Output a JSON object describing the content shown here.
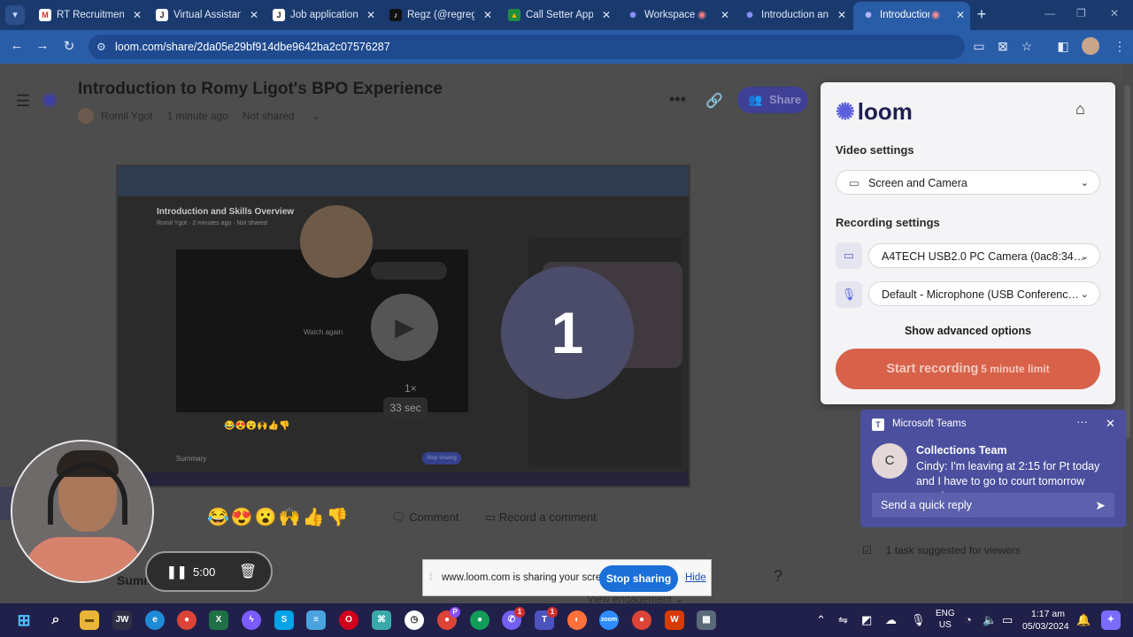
{
  "browser": {
    "tabs": [
      {
        "title": "RT Recruitment S",
        "icon": "gmail-icon",
        "color": "#d93025"
      },
      {
        "title": "Virtual Assistant",
        "icon": "jobstreet-icon",
        "color": "#222"
      },
      {
        "title": "Job application s",
        "icon": "jobstreet-icon",
        "color": "#222"
      },
      {
        "title": "Regz (@regregz",
        "icon": "tiktok-icon",
        "color": "#111"
      },
      {
        "title": "Call Setter Appli",
        "icon": "drive-icon",
        "color": "#f4b400"
      },
      {
        "title": "Workspace S",
        "icon": "loom-icon",
        "color": "#5c5fdc"
      },
      {
        "title": "Introduction and",
        "icon": "loom-icon",
        "color": "#5c5fdc"
      },
      {
        "title": "Introduction",
        "icon": "loom-icon",
        "color": "#5c5fdc"
      }
    ],
    "url": "loom.com/share/2da05e29bf914dbe9642ba2c07576287"
  },
  "page": {
    "title": "Introduction to Romy Ligot's BPO Experience",
    "author": "Romil Ygot",
    "time": "1 minute ago",
    "privacy": "Not shared",
    "share_label": "Share",
    "comment_label": "Comment",
    "record_comment_label": "Record a comment",
    "summary_label": "Summ",
    "view_engagement": "View engagement",
    "task_suggested": "1 task suggested for viewers",
    "reactions": "😂😍😮🙌👍👎"
  },
  "video_thumb": {
    "inner_title": "Introduction and Skills Overview",
    "inner_meta": "Romil Ygot · 2 minutes ago · Not shared",
    "watch_again": "Watch again",
    "speed": "1×",
    "duration": "33 sec",
    "summary": "Summary",
    "stop_sharing": "Stop sharing"
  },
  "countdown": "1",
  "recorder": {
    "timer": "5:00"
  },
  "loom_popup": {
    "brand": "loom",
    "video_settings_label": "Video settings",
    "video_mode": "Screen and Camera",
    "recording_settings_label": "Recording settings",
    "camera": "A4TECH USB2.0 PC Camera (0ac8:34…",
    "microphone": "Default - Microphone (USB Conferenc…",
    "advanced": "Show advanced options",
    "start_label": "Start recording",
    "limit_label": "5 minute limit"
  },
  "teams": {
    "app": "Microsoft Teams",
    "avatar_letter": "C",
    "sender": "Collections Team",
    "message": "Cindy: I'm leaving at 2:15 for Pt today and I have to go to court tomorrow morning...",
    "reply_placeholder": "Send a quick reply"
  },
  "share_bar": {
    "message": "www.loom.com is sharing your screen.",
    "stop_label": "Stop sharing",
    "hide_label": "Hide"
  },
  "taskbar": {
    "lang_line1": "ENG",
    "lang_line2": "US",
    "time": "1:17 am",
    "date": "05/03/2024"
  },
  "colors": {
    "browser_frame": "#1a3a6e",
    "loom_accent": "#5c5fdc",
    "start_recording": "#d8614a",
    "teams": "#4b4f9e",
    "stop_sharing": "#1a6fd8"
  }
}
